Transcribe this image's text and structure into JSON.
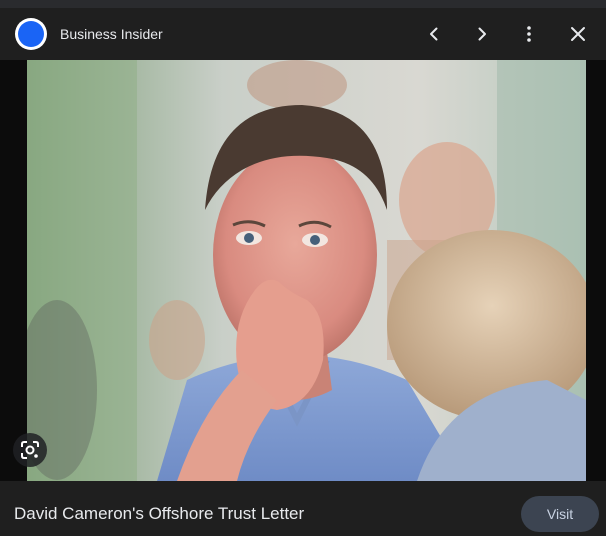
{
  "header": {
    "logo_icon": "business-insider-logo",
    "source_name": "Business Insider",
    "icons": [
      "chevron-left-icon",
      "chevron-right-icon",
      "more-vert-icon",
      "close-icon"
    ]
  },
  "image": {
    "kind": "news-photo"
  },
  "footer": {
    "caption": "David Cameron's Offshore Trust Letter",
    "visit_label": "Visit"
  },
  "colors": {
    "panel_bg": "#202124",
    "text": "#e8eaed",
    "visit_bg": "#3c4451",
    "logo_blue": "#1a64f5"
  }
}
